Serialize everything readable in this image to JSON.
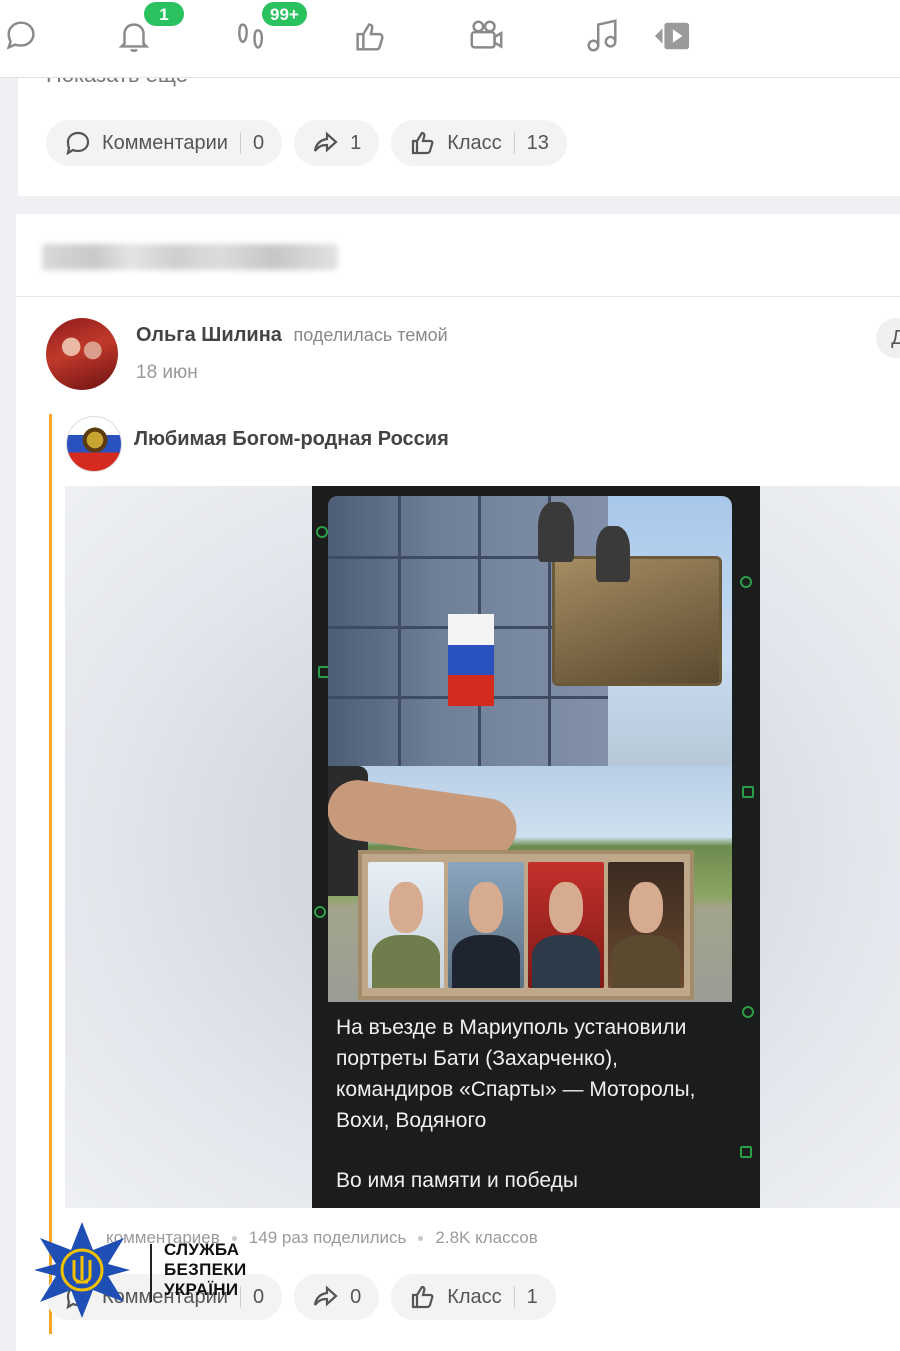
{
  "toolbar": {
    "items": [
      {
        "icon": "chat-bubbles-icon"
      },
      {
        "icon": "bell-icon",
        "badge": "1"
      },
      {
        "icon": "footprints-icon",
        "badge": "99+"
      },
      {
        "icon": "thumbs-up-icon"
      },
      {
        "icon": "video-camera-icon"
      },
      {
        "icon": "music-note-icon"
      },
      {
        "icon": "play-icon"
      }
    ],
    "badge_color": "#29c25f"
  },
  "post1": {
    "show_more": "Показать еще",
    "actions": {
      "comments_label": "Комментарии",
      "comments_count": "0",
      "shares_count": "1",
      "like_label": "Класс",
      "like_count": "13"
    }
  },
  "post2": {
    "author_name": "Ольга Шилина",
    "author_action": "поделилась темой",
    "date": "18 июн",
    "more_label": "Д",
    "group_name": "Любимая Богом-родная Россия",
    "image_caption": {
      "line1": "На въезде в Мариуполь установили портреты Бати (Захарченко), командиров «Спарты» — Моторолы, Вохи, Водяного",
      "line2": "Во имя памяти и победы"
    },
    "stats": {
      "comments": "комментариев",
      "shares": "149 раз поделились",
      "likes": "2.8K классов"
    },
    "actions": {
      "comments_label": "Комментарии",
      "comments_count": "0",
      "shares_count": "0",
      "like_label": "Класс",
      "like_count": "1"
    }
  },
  "watermark": {
    "line1": "СЛУЖБА",
    "line2": "БЕЗПЕКИ",
    "line3": "УКРАЇНИ",
    "star_color": "#1f4fb4",
    "trident_color": "#f2c200"
  },
  "colors": {
    "accent_orange": "#f5a623",
    "badge_green": "#29c25f"
  }
}
